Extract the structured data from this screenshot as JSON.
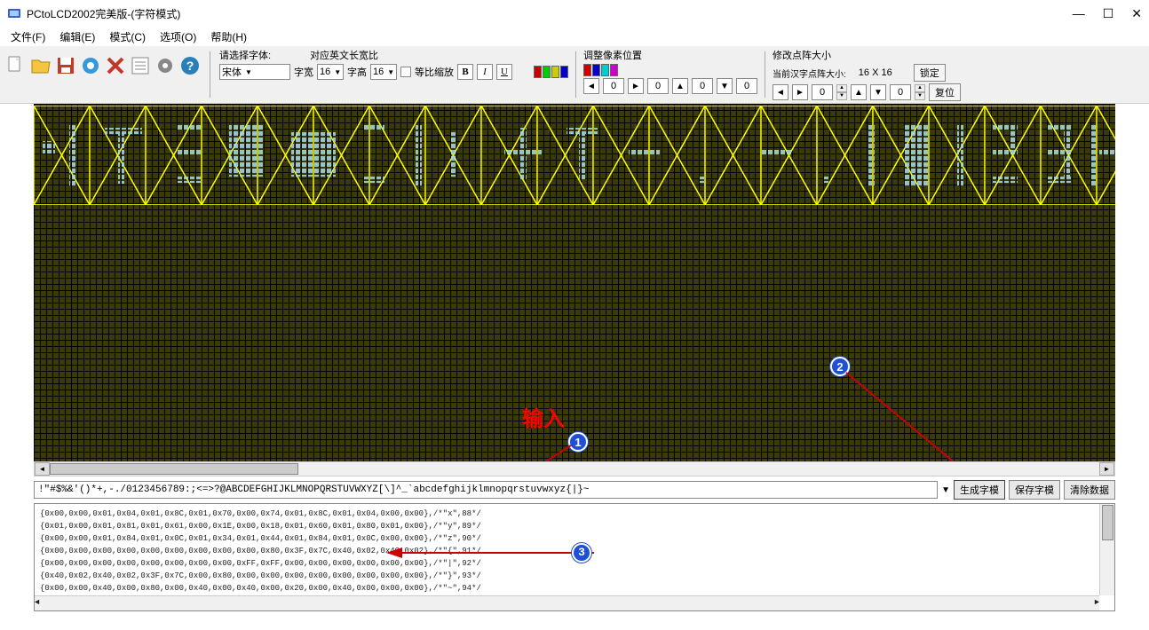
{
  "title": "PCtoLCD2002完美版-(字符模式)",
  "menu": {
    "file": "文件(F)",
    "edit": "编辑(E)",
    "mode": "模式(C)",
    "options": "选项(O)",
    "help": "帮助(H)"
  },
  "font": {
    "select_label": "请选择字体:",
    "name": "宋体",
    "width_label": "字宽",
    "width": "16",
    "height_label": "字高",
    "height": "16",
    "ratio_label": "对应英文长宽比",
    "scale_label": "等比缩放"
  },
  "pixel_section": {
    "label": "调整像素位置",
    "v1": "0",
    "v2": "0",
    "v3": "0",
    "v4": "0"
  },
  "dot_section": {
    "label": "修改点阵大小",
    "sub_label": "当前汉字点阵大小:",
    "size": "16 X 16",
    "lock": "锁定",
    "reset": "复位",
    "n1": "0",
    "n2": "0"
  },
  "format": {
    "b": "B",
    "i": "I",
    "u": "U"
  },
  "annotations": {
    "input_label": "输入",
    "b1": "1",
    "b2": "2",
    "b3": "3"
  },
  "input_text": "!\"#$%&'()*+,-./0123456789:;<=>?@ABCDEFGHIJKLMNOPQRSTUVWXYZ[\\]^_`abcdefghijklmnopqrstuvwxyz{|}~",
  "buttons": {
    "generate": "生成字模",
    "save": "保存字模",
    "clear": "清除数据"
  },
  "output_lines": [
    "{0x00,0x00,0x01,0x04,0x01,0x8C,0x01,0x70,0x00,0x74,0x01,0x8C,0x01,0x04,0x00,0x00},/*\"x\",88*/",
    "{0x01,0x00,0x01,0x81,0x01,0x61,0x00,0x1E,0x00,0x18,0x01,0x60,0x01,0x80,0x01,0x00},/*\"y\",89*/",
    "{0x00,0x00,0x01,0x84,0x01,0x0C,0x01,0x34,0x01,0x44,0x01,0x84,0x01,0x0C,0x00,0x00},/*\"z\",90*/",
    "{0x00,0x00,0x00,0x00,0x00,0x00,0x00,0x00,0x00,0x80,0x3F,0x7C,0x40,0x02,0x40,0x02},/*\"{\",91*/",
    "{0x00,0x00,0x00,0x00,0x00,0x00,0x00,0x00,0xFF,0xFF,0x00,0x00,0x00,0x00,0x00,0x00},/*\"|\",92*/",
    "{0x40,0x02,0x40,0x02,0x3F,0x7C,0x00,0x80,0x00,0x00,0x00,0x00,0x00,0x00,0x00,0x00},/*\"}\",93*/",
    "{0x00,0x00,0x40,0x00,0x80,0x00,0x40,0x00,0x40,0x00,0x20,0x00,0x40,0x00,0x00,0x00},/*\"~\",94*/"
  ]
}
